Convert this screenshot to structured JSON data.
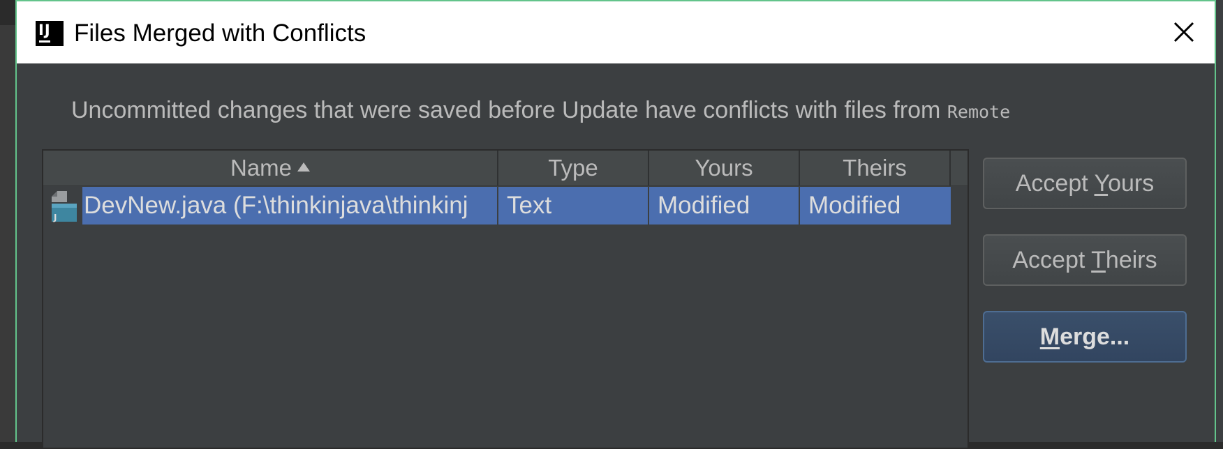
{
  "dialog": {
    "title": "Files Merged with Conflicts",
    "app_icon_text": "IJ",
    "border_color": "#63c48b",
    "message_prefix": "Uncommitted changes that were saved before Update have conflicts with files from ",
    "message_branch": "Remote"
  },
  "table": {
    "columns": {
      "name": "Name",
      "type": "Type",
      "yours": "Yours",
      "theirs": "Theirs"
    },
    "sort_column": "name",
    "sort_direction": "ascending",
    "rows": [
      {
        "icon": "java-file-icon",
        "name": "DevNew.java (F:\\thinkinjava\\thinkinj",
        "type": "Text",
        "yours": "Modified",
        "theirs": "Modified",
        "selected": true
      }
    ],
    "selection_color": "#4b6eaf"
  },
  "buttons": {
    "accept_yours": {
      "before": "Accept ",
      "mnemonic": "Y",
      "after": "ours"
    },
    "accept_theirs": {
      "before": "Accept ",
      "mnemonic": "T",
      "after": "heirs"
    },
    "merge": {
      "before": "",
      "mnemonic": "M",
      "after": "erge..."
    }
  },
  "icons": {
    "close": "close-icon",
    "app": "intellij-icon",
    "sort": "sort-ascending-icon"
  }
}
